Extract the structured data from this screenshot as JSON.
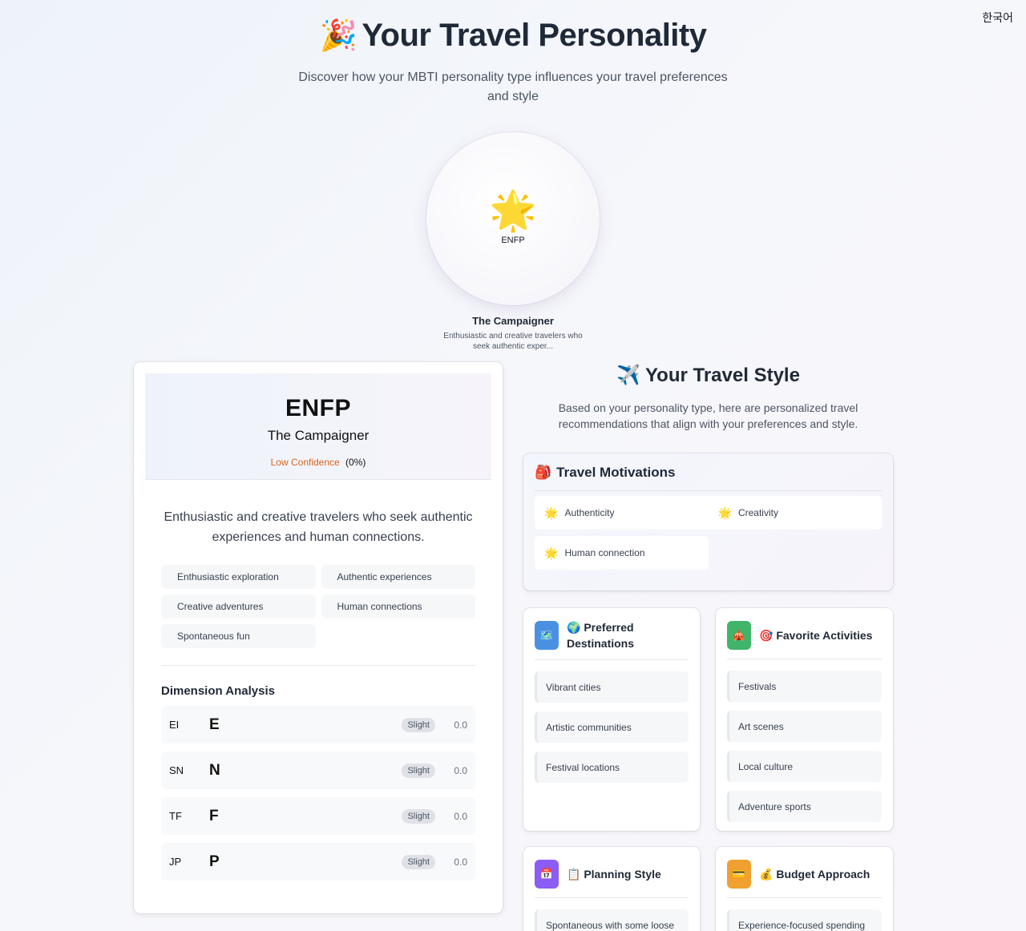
{
  "language_switch": "한국어",
  "hero": {
    "emoji": "🎉",
    "title": "Your Travel Personality",
    "subtitle": "Discover how your MBTI personality type influences your travel preferences and style"
  },
  "type_badge": {
    "icon": "🌟",
    "code": "ENFP",
    "name": "The Campaigner",
    "short_desc": "Enthusiastic and creative travelers who seek authentic exper..."
  },
  "result_card": {
    "type_code": "ENFP",
    "type_name": "The Campaigner",
    "confidence_label": "Low Confidence",
    "confidence_value": "(0%)",
    "description": "Enthusiastic and creative travelers who seek authentic experiences and human connections.",
    "traits": [
      "Enthusiastic exploration",
      "Authentic experiences",
      "Creative adventures",
      "Human connections",
      "Spontaneous fun"
    ],
    "dimension_title": "Dimension Analysis",
    "dimensions": [
      {
        "pair": "EI",
        "letter": "E",
        "strength": "Slight",
        "score": "0.0"
      },
      {
        "pair": "SN",
        "letter": "N",
        "strength": "Slight",
        "score": "0.0"
      },
      {
        "pair": "TF",
        "letter": "F",
        "strength": "Slight",
        "score": "0.0"
      },
      {
        "pair": "JP",
        "letter": "P",
        "strength": "Slight",
        "score": "0.0"
      }
    ]
  },
  "travel_style": {
    "emoji": "✈️",
    "title": "Your Travel Style",
    "description": "Based on your personality type, here are personalized travel recommendations that align with your preferences and style.",
    "motivations": {
      "emoji": "🎒",
      "title": "Travel Motivations",
      "item_icon": "🌟",
      "items": [
        "Authenticity",
        "Creativity",
        "Human connection"
      ]
    },
    "destinations": {
      "box_icon": "🗺️",
      "emoji": "🌍",
      "title_line1": "Preferred",
      "title_line2": "Destinations",
      "items": [
        "Vibrant cities",
        "Artistic communities",
        "Festival locations"
      ]
    },
    "activities": {
      "box_icon": "🎪",
      "emoji": "🎯",
      "title": "Favorite Activities",
      "items": [
        "Festivals",
        "Art scenes",
        "Local culture",
        "Adventure sports"
      ]
    },
    "planning": {
      "box_icon": "📅",
      "emoji": "📋",
      "title": "Planning Style",
      "items": [
        "Spontaneous with some loose"
      ]
    },
    "budget": {
      "box_icon": "💳",
      "emoji": "💰",
      "title": "Budget Approach",
      "items": [
        "Experience-focused spending"
      ]
    }
  },
  "colors": {
    "accent_orange": "#d9641e",
    "destinations_box": "#4a90e2",
    "activities_box": "#3fb46a",
    "planning_box": "#8b5cf6",
    "budget_box": "#f0a030"
  }
}
